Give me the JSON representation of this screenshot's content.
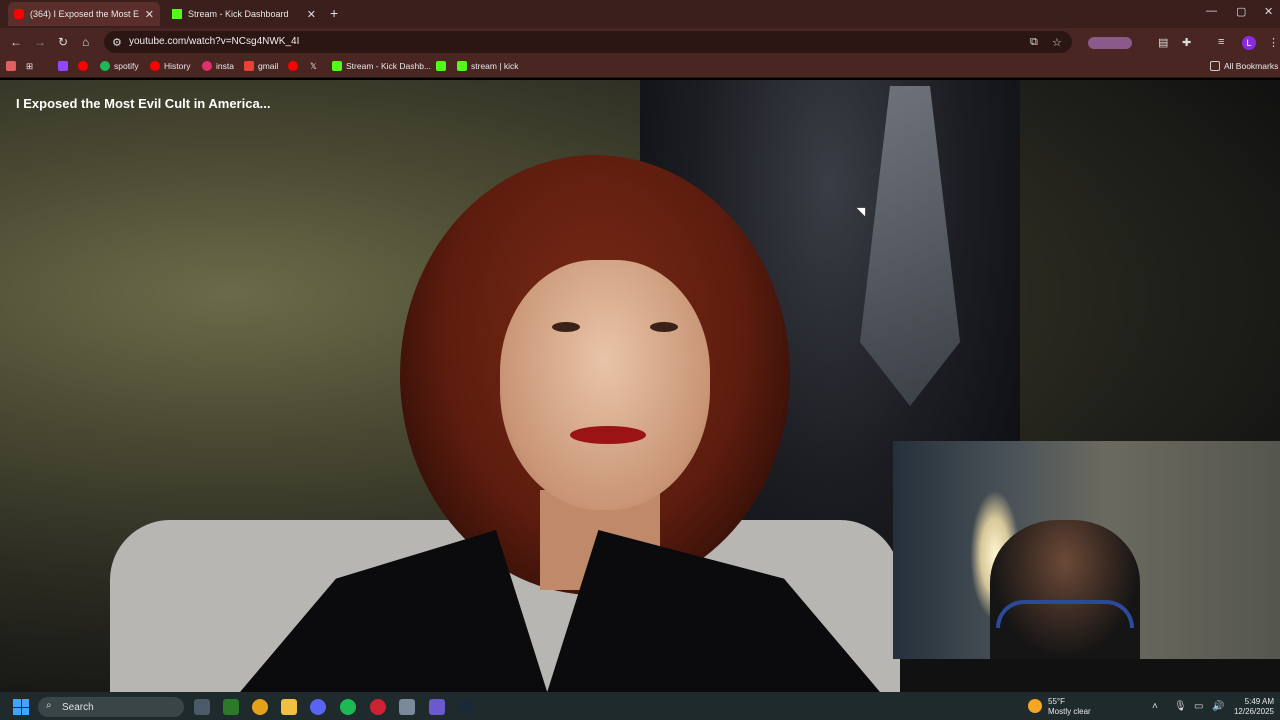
{
  "browser": {
    "tabs": [
      {
        "title": "(364) I Exposed the Most E",
        "favicon_color": "#ff0000",
        "active": true
      },
      {
        "title": "Stream - Kick Dashboard",
        "favicon_color": "#53fc18",
        "active": false
      }
    ],
    "new_tab_symbol": "+",
    "url": "youtube.com/watch?v=NCsg4NWK_4I",
    "bookmarks": [
      {
        "label": "spotify",
        "color": "#1db954"
      },
      {
        "label": "History",
        "color": "#ff0000"
      },
      {
        "label": "insta",
        "color": "#e1306c"
      },
      {
        "label": "gmail",
        "color": "#ea4335"
      },
      {
        "label": "Stream - Kick Dashb...",
        "color": "#53fc18"
      },
      {
        "label": "stream | kick",
        "color": "#53fc18"
      }
    ],
    "all_bookmarks_label": "All Bookmarks"
  },
  "video": {
    "title": "I Exposed the Most Evil Cult in America..."
  },
  "taskbar": {
    "search_label": "Search",
    "weather_temp": "55°F",
    "weather_desc": "Mostly clear",
    "time": "5:49 AM",
    "date": "12/26/2025"
  }
}
